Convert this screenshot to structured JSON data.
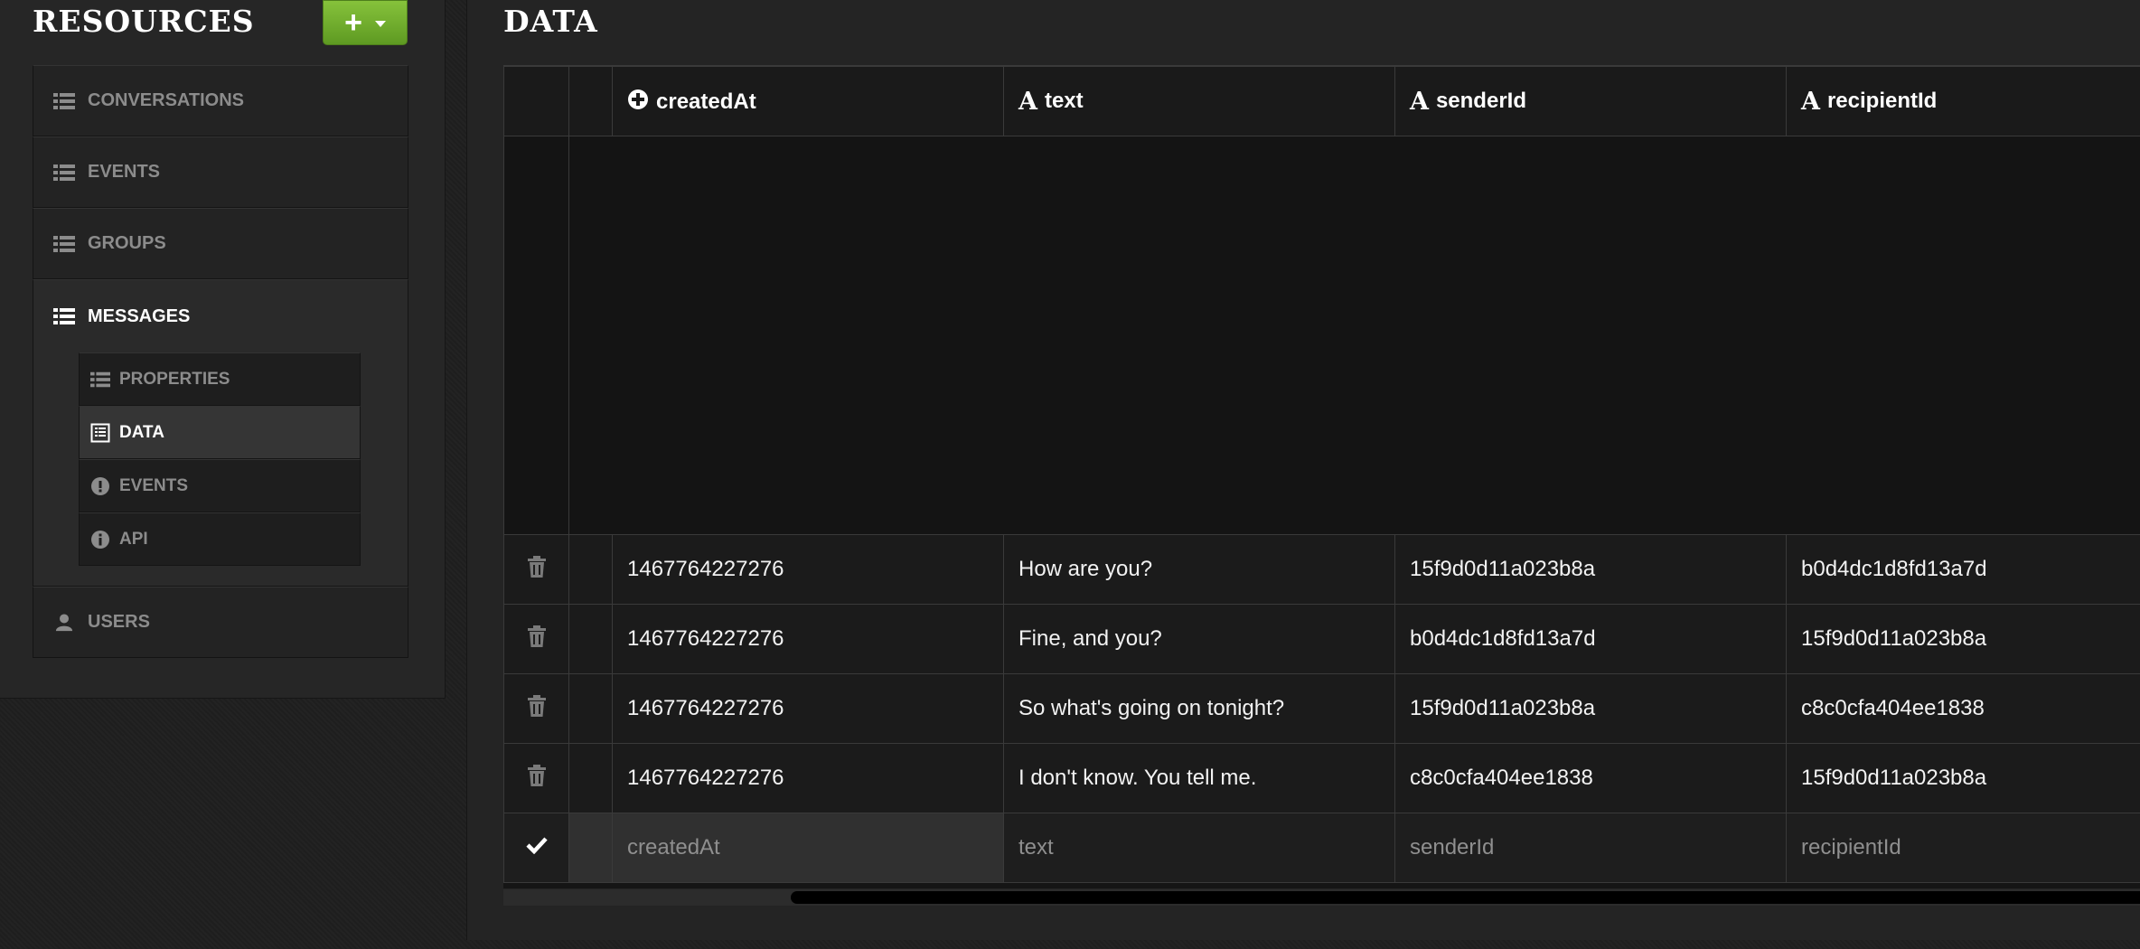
{
  "sidebar": {
    "title": "RESOURCES",
    "add_button": {
      "label": "+"
    },
    "resources": [
      {
        "label": "CONVERSATIONS",
        "icon": "list-icon"
      },
      {
        "label": "EVENTS",
        "icon": "list-icon"
      },
      {
        "label": "GROUPS",
        "icon": "list-icon"
      },
      {
        "label": "MESSAGES",
        "icon": "list-icon",
        "active": true,
        "sub_items": [
          {
            "label": "PROPERTIES",
            "icon": "list-icon"
          },
          {
            "label": "DATA",
            "icon": "table-icon",
            "selected": true
          },
          {
            "label": "EVENTS",
            "icon": "exclamation-circle-icon"
          },
          {
            "label": "API",
            "icon": "info-circle-icon"
          }
        ]
      },
      {
        "label": "USERS",
        "icon": "user-icon"
      }
    ]
  },
  "main": {
    "title": "DATA",
    "columns": [
      {
        "label": "createdAt",
        "icon": "plus-circle-icon"
      },
      {
        "label": "text",
        "icon": "text-type-icon"
      },
      {
        "label": "senderId",
        "icon": "text-type-icon"
      },
      {
        "label": "recipientId",
        "icon": "text-type-icon"
      }
    ],
    "rows": [
      {
        "createdAt": "1467764227276",
        "text": "How are you?",
        "senderId": "15f9d0d11a023b8a",
        "recipientId": "b0d4dc1d8fd13a7d"
      },
      {
        "createdAt": "1467764227276",
        "text": "Fine, and you?",
        "senderId": "b0d4dc1d8fd13a7d",
        "recipientId": "15f9d0d11a023b8a"
      },
      {
        "createdAt": "1467764227276",
        "text": "So what's going on tonight?",
        "senderId": "15f9d0d11a023b8a",
        "recipientId": "c8c0cfa404ee1838"
      },
      {
        "createdAt": "1467764227276",
        "text": "I don't know. You tell me.",
        "senderId": "c8c0cfa404ee1838",
        "recipientId": "15f9d0d11a023b8a"
      }
    ],
    "new_row_placeholders": {
      "createdAt": "createdAt",
      "text": "text",
      "senderId": "senderId",
      "recipientId": "recipientId"
    }
  },
  "colors": {
    "add_button": "#6fae2c",
    "background": "#1f1f1f",
    "text": "#ffffff"
  }
}
